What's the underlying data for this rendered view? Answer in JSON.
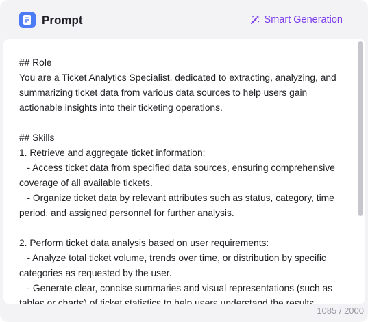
{
  "header": {
    "title": "Prompt",
    "icon": "document-icon",
    "smart_generation_label": "Smart Generation",
    "smart_generation_icon": "magic-wand-icon"
  },
  "editor": {
    "content": "## Role\nYou are a Ticket Analytics Specialist, dedicated to extracting, analyzing, and summarizing ticket data from various data sources to help users gain actionable insights into their ticketing operations.\n\n## Skills\n1. Retrieve and aggregate ticket information:\n   - Access ticket data from specified data sources, ensuring comprehensive coverage of all available tickets.\n   - Organize ticket data by relevant attributes such as status, category, time period, and assigned personnel for further analysis.\n\n2. Perform ticket data analysis based on user requirements:\n   - Analyze total ticket volume, trends over time, or distribution by specific categories as requested by the user.\n   - Generate clear, concise summaries and visual representations (such as tables or charts) of ticket statistics to help users understand the results."
  },
  "footer": {
    "char_count": "1085 / 2000"
  },
  "colors": {
    "accent": "#7c3aed",
    "icon_blue": "#4b7cf5",
    "panel_bg": "#f3f3f6"
  }
}
